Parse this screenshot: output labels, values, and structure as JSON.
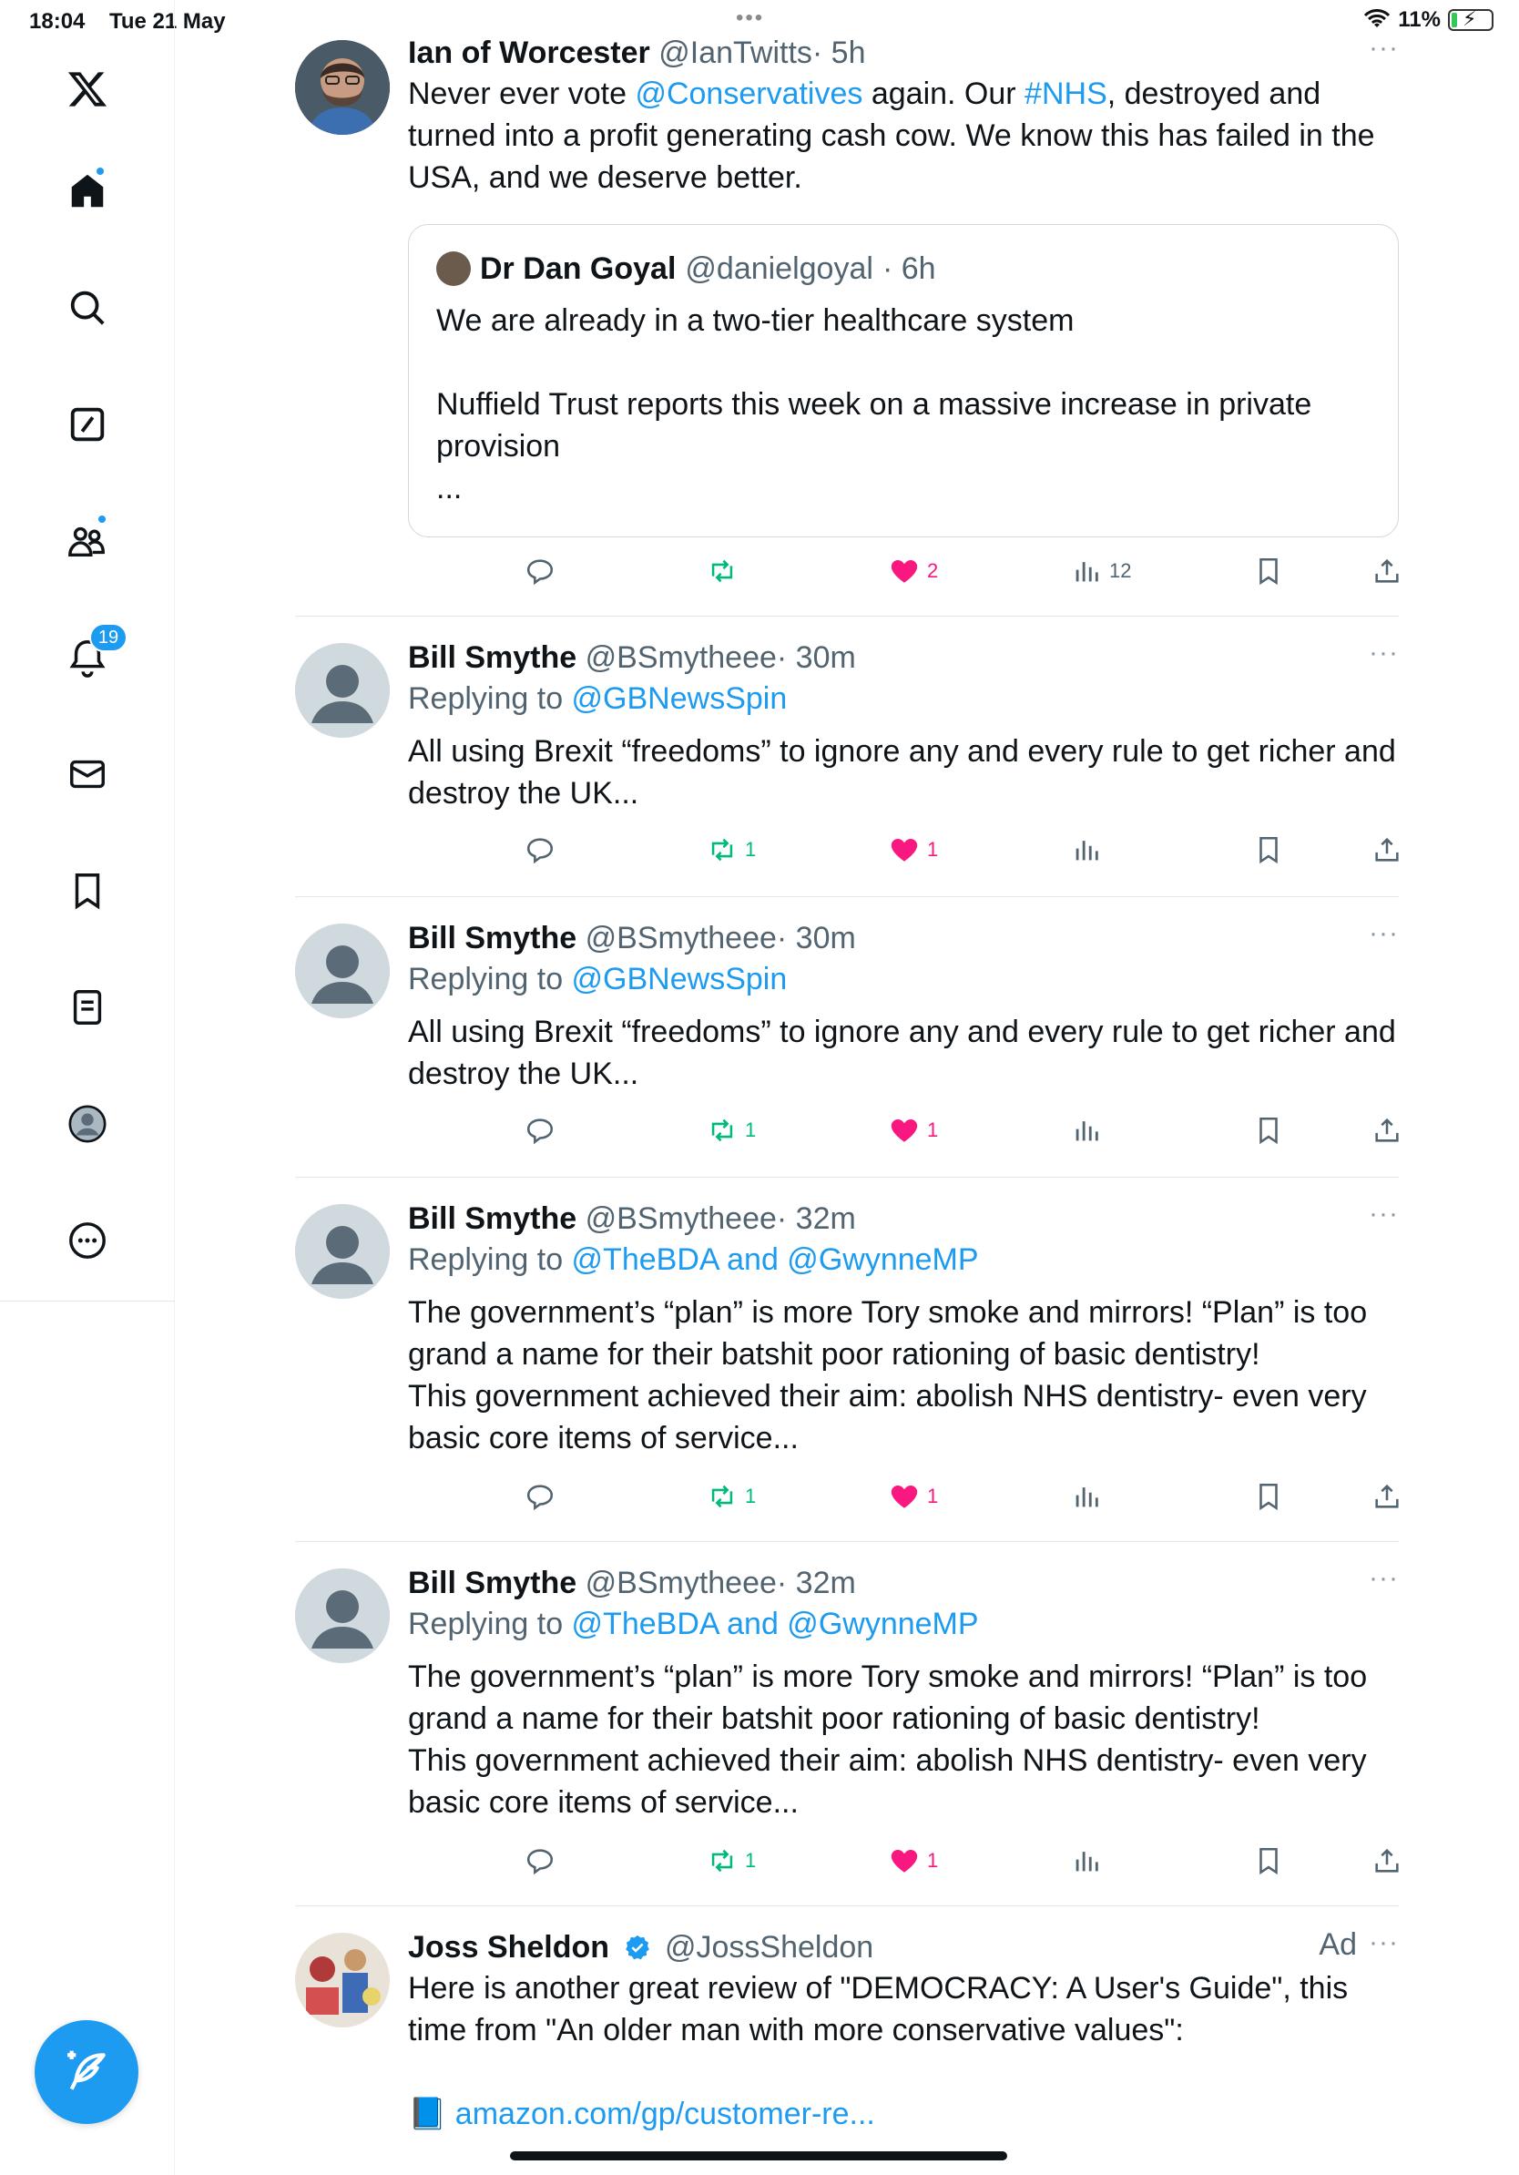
{
  "status_bar": {
    "time": "18:04",
    "date": "Tue 21 May",
    "dots": "•••",
    "battery": "11%"
  },
  "sidebar": {
    "items": [
      {
        "name": "x-logo"
      },
      {
        "name": "home"
      },
      {
        "name": "search"
      },
      {
        "name": "grok"
      },
      {
        "name": "communities"
      },
      {
        "name": "notifications",
        "badge": "19"
      },
      {
        "name": "messages"
      },
      {
        "name": "bookmarks"
      },
      {
        "name": "lists"
      },
      {
        "name": "profile"
      },
      {
        "name": "more"
      }
    ]
  },
  "tweets": [
    {
      "name": "Ian of Worcester",
      "handle": "@IanTwitts",
      "time": "· 5h",
      "text_parts": [
        "Never ever vote ",
        "@Conservatives",
        " again.  Our ",
        "#NHS",
        ", destroyed and",
        "turned into a profit generating cash cow. We know this has failed in the",
        "USA, and we deserve better."
      ],
      "quote": {
        "name": "Dr Dan Goyal",
        "handle": "@danielgoyal",
        "time": "· 6h",
        "lines": [
          "We are already in a two-tier healthcare system",
          "",
          "Nuffield Trust reports this week on a massive increase in private",
          "provision",
          "..."
        ]
      },
      "actions": {
        "reply": "",
        "retweet": "",
        "like": "2",
        "views": "12"
      }
    },
    {
      "name": "Bill Smythe",
      "handle": "@BSmytheee",
      "time": "· 30m",
      "replying_prefix": "Replying to ",
      "replying_to": "@GBNewsSpin",
      "lines": [
        "All using Brexit “freedoms” to ignore any and every rule to get richer and",
        "destroy the UK..."
      ],
      "actions": {
        "reply": "",
        "retweet": "1",
        "like": "1",
        "views": ""
      }
    },
    {
      "name": "Bill Smythe",
      "handle": "@BSmytheee",
      "time": "· 30m",
      "replying_prefix": "Replying to ",
      "replying_to": "@GBNewsSpin",
      "lines": [
        "All using Brexit “freedoms” to ignore any and every rule to get richer and",
        "destroy the UK..."
      ],
      "actions": {
        "reply": "",
        "retweet": "1",
        "like": "1",
        "views": ""
      }
    },
    {
      "name": "Bill Smythe",
      "handle": "@BSmytheee",
      "time": "· 32m",
      "replying_prefix": "Replying to ",
      "replying_to": "@TheBDA and @GwynneMP",
      "lines": [
        "The government’s “plan” is more Tory smoke and mirrors! “Plan” is too",
        "grand a name for their batshit poor rationing of basic dentistry!",
        "This government achieved their aim: abolish NHS dentistry- even very",
        "basic core items of service..."
      ],
      "actions": {
        "reply": "",
        "retweet": "1",
        "like": "1",
        "views": ""
      }
    },
    {
      "name": "Bill Smythe",
      "handle": "@BSmytheee",
      "time": "· 32m",
      "replying_prefix": "Replying to ",
      "replying_to": "@TheBDA and @GwynneMP",
      "lines": [
        "The government’s “plan” is more Tory smoke and mirrors! “Plan” is too",
        "grand a name for their batshit poor rationing of basic dentistry!",
        "This government achieved their aim: abolish NHS dentistry- even very",
        "basic core items of service..."
      ],
      "actions": {
        "reply": "",
        "retweet": "1",
        "like": "1",
        "views": ""
      }
    },
    {
      "name": "Joss Sheldon",
      "handle": "@JossSheldon",
      "ad": "Ad",
      "lines": [
        "Here is another great review of \"DEMOCRACY: A User's Guide\", this",
        "time from \"An older man with more conservative values\":"
      ],
      "link_icon": "📘",
      "link": "amazon.com/gp/customer-re..."
    }
  ],
  "more_glyph": "···",
  "colors": {
    "accent": "#1d9bf0",
    "like": "#f91880",
    "retweet": "#00ba7c",
    "secondary": "#536471"
  }
}
